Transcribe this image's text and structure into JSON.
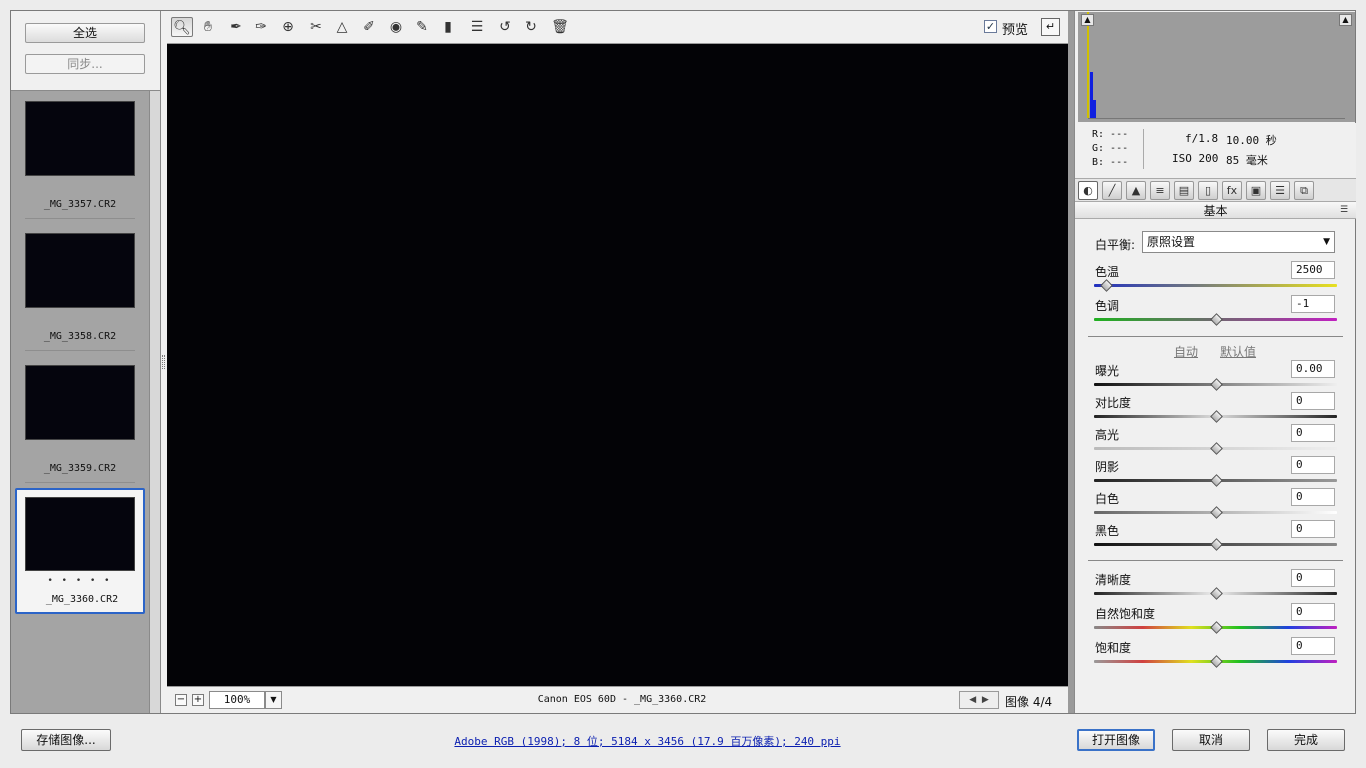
{
  "filmstrip": {
    "select_all": "全选",
    "sync": "同步...",
    "items": [
      {
        "name": "_MG_3357.CR2",
        "rating": ""
      },
      {
        "name": "_MG_3358.CR2",
        "rating": ""
      },
      {
        "name": "_MG_3359.CR2",
        "rating": ""
      },
      {
        "name": "_MG_3360.CR2",
        "rating": "• • • • •",
        "selected": true
      }
    ]
  },
  "toolbar": {
    "tools": [
      "zoom-icon",
      "hand-icon",
      "white-balance-icon",
      "color-sampler-icon",
      "target-adjust-icon",
      "crop-icon",
      "straighten-icon",
      "spot-removal-icon",
      "red-eye-icon",
      "adjustment-brush-icon",
      "graduated-filter-icon",
      "preferences-icon",
      "rotate-ccw-icon",
      "rotate-cw-icon",
      "trash-icon"
    ],
    "preview_label": "预览",
    "preview_checked": true
  },
  "preview_status": {
    "zoom": "100%",
    "caption": "Canon EOS 60D -  _MG_3360.CR2",
    "image_count": "图像 4/4"
  },
  "camera_info": {
    "r": "R: ---",
    "g": "G: ---",
    "b": "B: ---",
    "aperture": "f/1.8",
    "shutter": "10.00 秒",
    "iso": "ISO 200",
    "focal": "85 毫米"
  },
  "panel": {
    "section_title": "基本",
    "wb_label": "白平衡:",
    "wb_value": "原照设置",
    "auto": "自动",
    "default": "默认值",
    "sliders": [
      {
        "label": "色温",
        "value": "2500",
        "level": 0.05
      },
      {
        "label": "色调",
        "value": "-1",
        "level": 0.5
      },
      {
        "label": "曝光",
        "value": "0.00",
        "level": 0.5
      },
      {
        "label": "对比度",
        "value": "0",
        "level": 0.5
      },
      {
        "label": "高光",
        "value": "0",
        "level": 0.5
      },
      {
        "label": "阴影",
        "value": "0",
        "level": 0.5
      },
      {
        "label": "白色",
        "value": "0",
        "level": 0.5
      },
      {
        "label": "黑色",
        "value": "0",
        "level": 0.5
      },
      {
        "label": "清晰度",
        "value": "0",
        "level": 0.5
      },
      {
        "label": "自然饱和度",
        "value": "0",
        "level": 0.5
      },
      {
        "label": "饱和度",
        "value": "0",
        "level": 0.5
      }
    ]
  },
  "footer": {
    "save": "存储图像...",
    "workflow": "Adobe RGB (1998); 8 位; 5184 x 3456 (17.9 百万像素); 240 ppi",
    "open": "打开图像",
    "cancel": "取消",
    "done": "完成"
  },
  "colors": {
    "accent": "#3a72c8",
    "link": "#0b1fb0",
    "canvas": "#030306"
  }
}
